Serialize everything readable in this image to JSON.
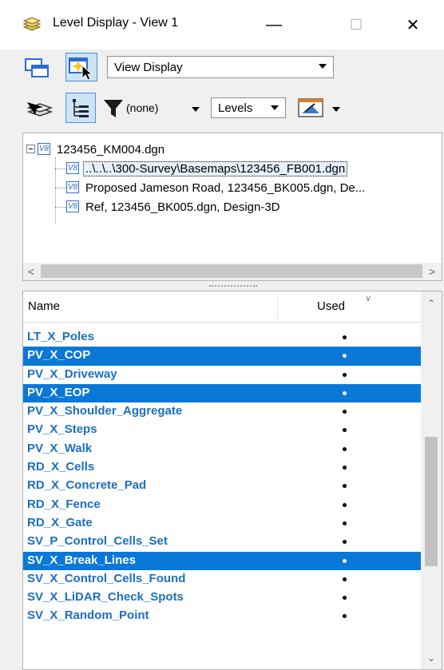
{
  "window": {
    "title": "Level Display - View 1",
    "minimize": "—",
    "maximize": "☐",
    "close": "✕"
  },
  "toolbar": {
    "display_mode": "View Display",
    "filter_value": "(none)",
    "mode": "Levels"
  },
  "tree": {
    "root": "123456_KM004.dgn",
    "children": [
      "..\\..\\..\\300-Survey\\Basemaps\\123456_FB001.dgn",
      "Proposed Jameson Road, 123456_BK005.dgn, De...",
      "Ref, 123456_BK005.dgn, Design-3D"
    ],
    "icon_text": "V8"
  },
  "list": {
    "col_name": "Name",
    "col_used": "Used",
    "rows": [
      {
        "name": "LT_X_Poles",
        "selected": false
      },
      {
        "name": "PV_X_COP",
        "selected": true
      },
      {
        "name": "PV_X_Driveway",
        "selected": false
      },
      {
        "name": "PV_X_EOP",
        "selected": true
      },
      {
        "name": "PV_X_Shoulder_Aggregate",
        "selected": false
      },
      {
        "name": "PV_X_Steps",
        "selected": false
      },
      {
        "name": "PV_X_Walk",
        "selected": false
      },
      {
        "name": "RD_X_Cells",
        "selected": false
      },
      {
        "name": "RD_X_Concrete_Pad",
        "selected": false
      },
      {
        "name": "RD_X_Fence",
        "selected": false
      },
      {
        "name": "RD_X_Gate",
        "selected": false
      },
      {
        "name": "SV_P_Control_Cells_Set",
        "selected": false
      },
      {
        "name": "SV_X_Break_Lines",
        "selected": true
      },
      {
        "name": "SV_X_Control_Cells_Found",
        "selected": false
      },
      {
        "name": "SV_X_LiDAR_Check_Spots",
        "selected": false
      },
      {
        "name": "SV_X_Random_Point",
        "selected": false
      }
    ]
  },
  "colors": {
    "accent": "#0a78d7",
    "level_text": "#1b6ec2"
  }
}
